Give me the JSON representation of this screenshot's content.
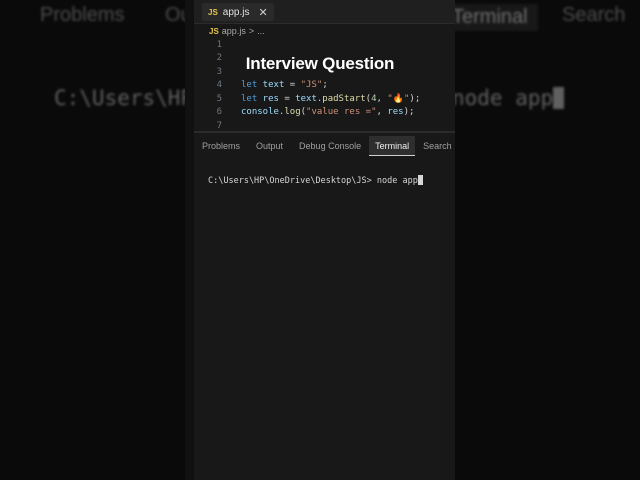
{
  "background": {
    "tabs": [
      "Problems",
      "Ou",
      "Terminal",
      "Search"
    ],
    "left_code": "C:\\Users\\HP",
    "right_code": "node app"
  },
  "editor": {
    "tab_badge": "JS",
    "tab_name": "app.js",
    "breadcrumb_file": "app.js",
    "breadcrumb_sep": ">",
    "breadcrumb_more": "...",
    "line_numbers": [
      "1",
      "2",
      "3",
      "4",
      "5",
      "6",
      "7"
    ],
    "code": {
      "l4_kw": "let",
      "l4_var": " text ",
      "l4_eq": "= ",
      "l4_str": "\"JS\"",
      "l4_end": ";",
      "l5_kw": "let",
      "l5_var": " res ",
      "l5_eq": "= ",
      "l5_obj": "text.",
      "l5_fn": "padStart",
      "l5_open": "(",
      "l5_num": "4",
      "l5_comma": ", ",
      "l5_str_a": "\"",
      "l5_emoji": "🔥",
      "l5_str_b": "\"",
      "l5_end": ");",
      "l6_obj": "console.",
      "l6_fn": "log",
      "l6_open": "(",
      "l6_str": "\"value res =\"",
      "l6_comma": ", ",
      "l6_var": "res",
      "l6_end": ");"
    }
  },
  "overlay_title": "Interview Question",
  "panel_tabs": [
    "Problems",
    "Output",
    "Debug Console",
    "Terminal",
    "Search"
  ],
  "active_panel_tab": "Terminal",
  "terminal": {
    "prompt": "C:\\Users\\HP\\OneDrive\\Desktop\\JS> ",
    "command": "node app"
  },
  "colors": {
    "keyword": "#c586c0",
    "string": "#ce9178",
    "number": "#b5cea8",
    "function": "#dcdcaa",
    "js_badge": "#e8c547"
  }
}
